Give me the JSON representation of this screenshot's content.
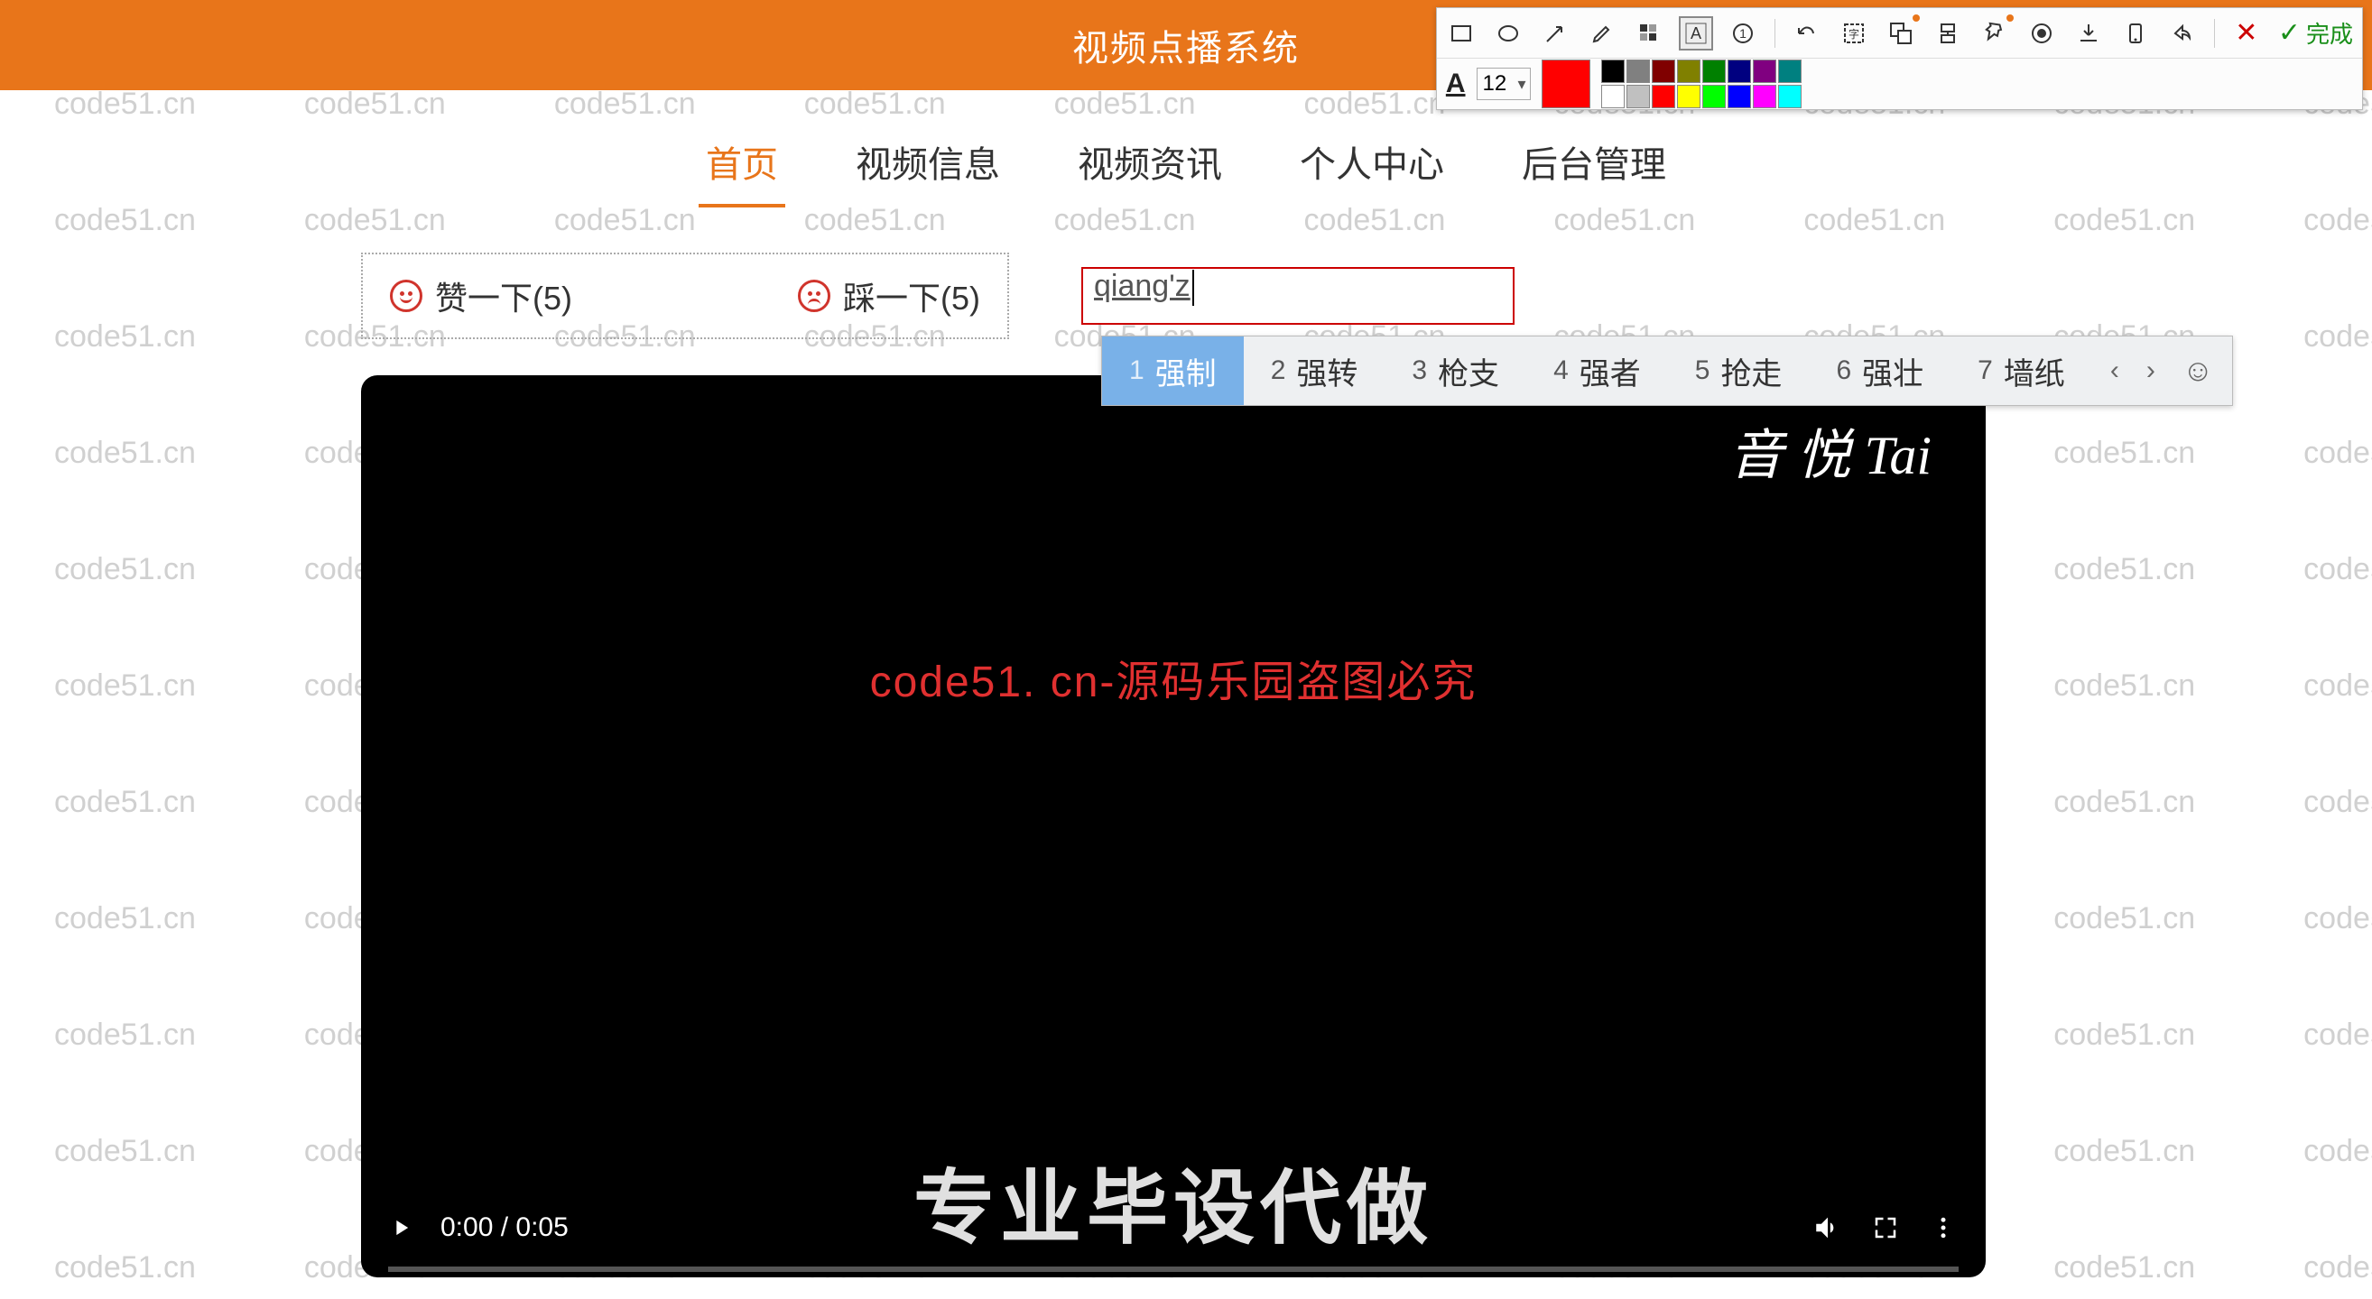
{
  "header": {
    "title": "视频点播系统"
  },
  "nav": {
    "items": [
      {
        "label": "首页",
        "active": true
      },
      {
        "label": "视频信息"
      },
      {
        "label": "视频资讯"
      },
      {
        "label": "个人中心"
      },
      {
        "label": "后台管理"
      }
    ]
  },
  "interact": {
    "like_label": "赞一下(5)",
    "dislike_label": "踩一下(5)",
    "input_composing": "qiang'z"
  },
  "ime": {
    "candidates": [
      {
        "n": "1",
        "text": "强制",
        "selected": true
      },
      {
        "n": "2",
        "text": "强转"
      },
      {
        "n": "3",
        "text": "枪支"
      },
      {
        "n": "4",
        "text": "强者"
      },
      {
        "n": "5",
        "text": "抢走"
      },
      {
        "n": "6",
        "text": "强壮"
      },
      {
        "n": "7",
        "text": "墙纸"
      }
    ],
    "prev": "‹",
    "next": "›",
    "emoji": "☺"
  },
  "video": {
    "logo_text": "音 悦 Tai",
    "overlay_red": "code51. cn-源码乐园盗图必究",
    "caption": "专业毕设代做",
    "time": "0:00 / 0:05"
  },
  "annot": {
    "font_size": "12",
    "finish_label": "完成",
    "selected_color": "#ff0000",
    "palette_row1": [
      "#000000",
      "#808080",
      "#800000",
      "#808000",
      "#008000",
      "#000080",
      "#800080",
      "#008080"
    ],
    "palette_row2": [
      "#ffffff",
      "#c0c0c0",
      "#ff0000",
      "#ffff00",
      "#00ff00",
      "#0000ff",
      "#ff00ff",
      "#00ffff"
    ]
  },
  "watermark": {
    "text": "code51.cn"
  }
}
